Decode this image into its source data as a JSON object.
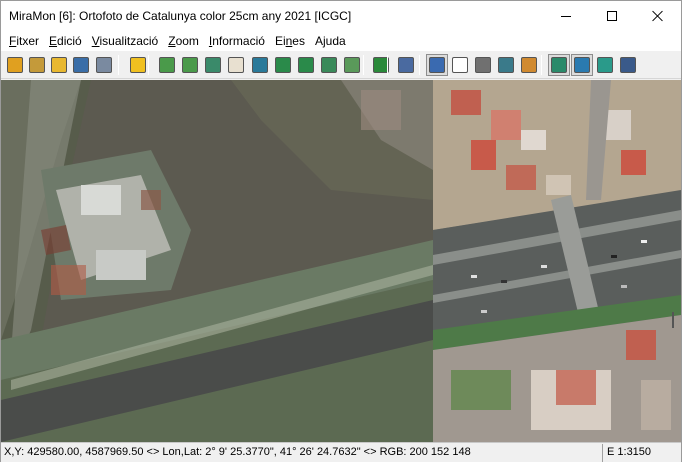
{
  "window": {
    "title": "MiraMon [6]:  Ortofoto de Catalunya color 25cm any 2021 [ICGC]"
  },
  "menu": [
    {
      "label": "Fitxer",
      "mnemonic": "F",
      "rest": "itxer"
    },
    {
      "label": "Edició",
      "mnemonic": "E",
      "rest": "dició"
    },
    {
      "label": "Visualització",
      "mnemonic": "V",
      "rest": "isualització"
    },
    {
      "label": "Zoom",
      "mnemonic": "Z",
      "rest": "oom"
    },
    {
      "label": "Informació",
      "mnemonic": "I",
      "rest": "nformació"
    },
    {
      "label": "Eines",
      "prefix": "Ei",
      "mnemonic": "n",
      "rest": "es"
    },
    {
      "label": "Ajuda",
      "prefix": "A",
      "mnemonic": "j",
      "rest": "uda"
    }
  ],
  "toolbar": {
    "buttons": [
      {
        "name": "new-map-icon",
        "color": "#e0a020"
      },
      {
        "name": "open-icon",
        "color": "#c49a3a"
      },
      {
        "name": "open-recent-icon",
        "color": "#e8b830"
      },
      {
        "name": "save-icon",
        "color": "#3a6ea8"
      },
      {
        "name": "print-icon",
        "color": "#7a8aa0"
      },
      {
        "name": "brightness-icon",
        "color": "#f0c020"
      },
      {
        "name": "zoom-in-icon",
        "color": "#4a9a4a"
      },
      {
        "name": "zoom-out-icon",
        "color": "#4a9a4a"
      },
      {
        "name": "zoom-window-icon",
        "color": "#3a8a6a"
      },
      {
        "name": "pan-hand-icon",
        "color": "#e8e0d0"
      },
      {
        "name": "view-all-icon",
        "color": "#2a7a9a"
      },
      {
        "name": "previous-view-icon",
        "color": "#2a8a4a"
      },
      {
        "name": "next-view-icon",
        "color": "#2a8a4a"
      },
      {
        "name": "zoom-layer-icon",
        "color": "#3a8a5a"
      },
      {
        "name": "zoom-selection-icon",
        "color": "#5a9a5a"
      },
      {
        "name": "refresh-icon",
        "color": "#2a8a3a"
      },
      {
        "name": "tools-icon",
        "color": "#4a6aa0"
      },
      {
        "name": "info-icon",
        "color": "#3a6ab0"
      },
      {
        "name": "select-arrow-icon",
        "color": "#ffffff"
      },
      {
        "name": "identify-icon",
        "color": "#707070"
      },
      {
        "name": "measure-icon",
        "color": "#3a7a8a"
      },
      {
        "name": "edit-pencil-icon",
        "color": "#d08a30"
      },
      {
        "name": "layers-icon",
        "color": "#2a8a6a"
      },
      {
        "name": "legend-icon",
        "color": "#2a7ab0"
      },
      {
        "name": "download-icon",
        "color": "#2a9a8a"
      },
      {
        "name": "table-icon",
        "color": "#3a5a8a"
      }
    ]
  },
  "status": {
    "coordinates": "X,Y: 429580.00, 4587969.50 <> Lon,Lat: 2° 9' 25.3770\", 41° 26' 24.7632\"  <> RGB: 200 152 148",
    "scale": "E 1:3150"
  }
}
